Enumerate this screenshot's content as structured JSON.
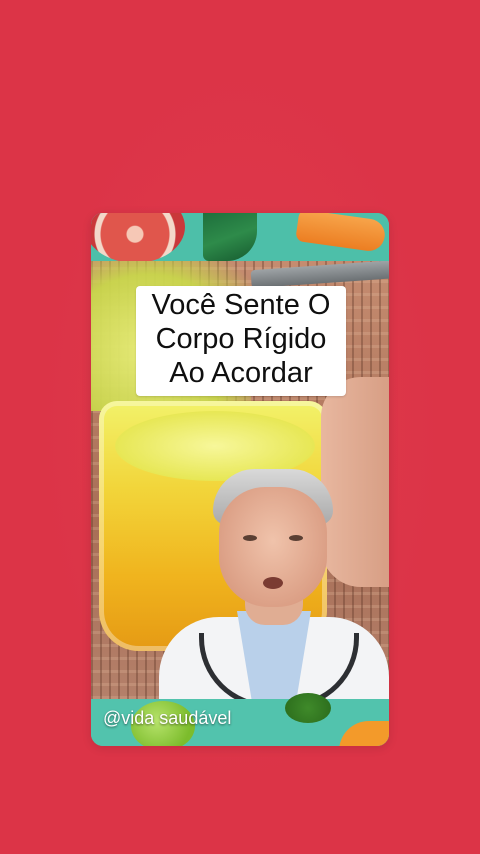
{
  "video": {
    "caption_lines": [
      "Você Sente O",
      "Corpo Rígido",
      "Ao Acordar"
    ],
    "handle": "@vida saudável"
  },
  "colors": {
    "page_background": "#dc3447",
    "banner_teal": "#52c3ad",
    "caption_background": "#ffffff",
    "caption_text": "#0f0f0f"
  },
  "icons": [
    "grapefruit",
    "cucumber",
    "carrot",
    "juice-glass",
    "doctor",
    "green-apple",
    "broccoli"
  ]
}
